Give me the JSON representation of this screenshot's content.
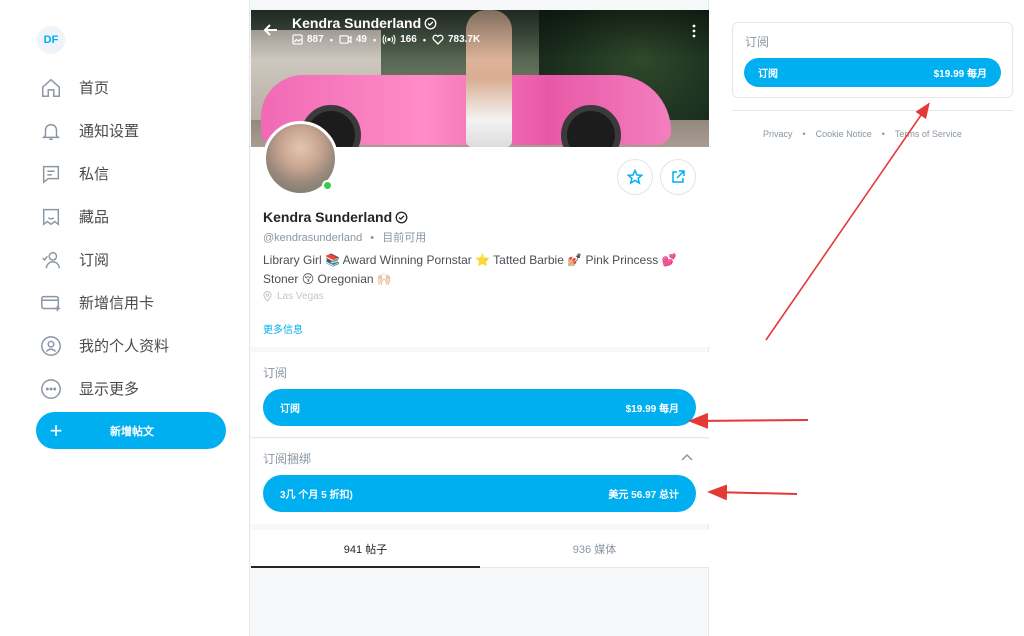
{
  "sidebar": {
    "user_initials": "DF",
    "items": [
      {
        "label": "首页",
        "icon": "home-icon"
      },
      {
        "label": "通知设置",
        "icon": "bell-icon"
      },
      {
        "label": "私信",
        "icon": "message-icon"
      },
      {
        "label": "藏品",
        "icon": "collections-icon"
      },
      {
        "label": "订阅",
        "icon": "subscriptions-icon"
      },
      {
        "label": "新增信用卡",
        "icon": "credit-card-icon"
      },
      {
        "label": "我的个人资料",
        "icon": "profile-icon"
      },
      {
        "label": "显示更多",
        "icon": "more-icon"
      }
    ],
    "new_post_label": "新增帖文"
  },
  "banner": {
    "name": "Kendra Sunderland",
    "stats": {
      "photos": "887",
      "videos": "49",
      "streams": "166",
      "likes": "783.7K"
    }
  },
  "profile": {
    "name": "Kendra Sunderland",
    "handle": "@kendrasunderland",
    "status": "目前可用",
    "bio_line1": "Library Girl 📚 Award Winning Pornstar ⭐ Tatted Barbie 💅🏼 Pink Princess 💕",
    "bio_line2": "Stoner 😚 Oregonian 🙌🏻",
    "location": "Las Vegas",
    "more_info": "更多信息"
  },
  "subscription": {
    "title": "订阅",
    "button_label": "订阅",
    "button_price": "$19.99 每月"
  },
  "bundles": {
    "title": "订阅捆绑",
    "button_label": "3几 个月 5 折扣)",
    "button_price": "美元 56.97 总计"
  },
  "tabs": [
    {
      "label": "941 帖子",
      "active": true
    },
    {
      "label": "936 媒体",
      "active": false
    }
  ],
  "right_panel": {
    "title": "订阅",
    "button_label": "订阅",
    "button_price": "$19.99 每月"
  },
  "footer": {
    "links": [
      "Privacy",
      "Cookie Notice",
      "Terms of Service"
    ]
  },
  "colors": {
    "accent": "#00aff0",
    "annotation_arrows": "#e53935",
    "online": "#3bca4f"
  }
}
